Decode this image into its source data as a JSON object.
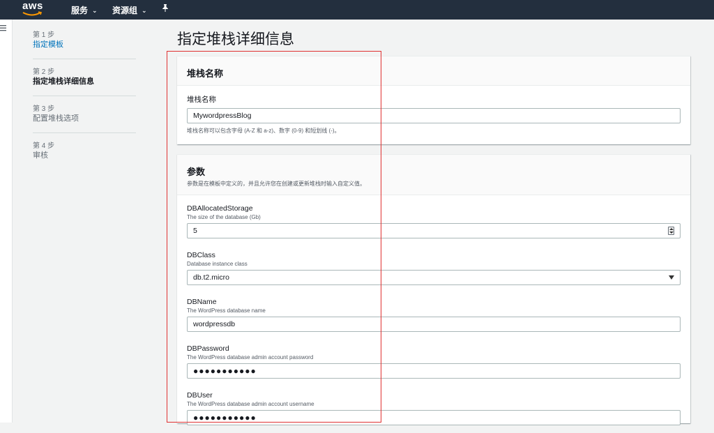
{
  "nav": {
    "logo": "aws",
    "services": "服务",
    "resource_groups": "资源组"
  },
  "steps": [
    {
      "num": "第 1 步",
      "title": "指定模板",
      "state": "link"
    },
    {
      "num": "第 2 步",
      "title": "指定堆栈详细信息",
      "state": "active"
    },
    {
      "num": "第 3 步",
      "title": "配置堆栈选项",
      "state": "inactive"
    },
    {
      "num": "第 4 步",
      "title": "审核",
      "state": "inactive"
    }
  ],
  "page_title": "指定堆栈详细信息",
  "stack_name_panel": {
    "header": "堆栈名称",
    "label": "堆栈名称",
    "value": "MywordpressBlog",
    "hint": "堆栈名称可以包含字母 (A-Z 和 a-z)、数字 (0-9) 和短划线 (-)。"
  },
  "params_panel": {
    "header": "参数",
    "description": "参数是在模板中定义的，并且允许您在创建或更新堆栈时输入自定义值。",
    "fields": [
      {
        "label": "DBAllocatedStorage",
        "desc": "The size of the database (Gb)",
        "value": "5",
        "type": "number"
      },
      {
        "label": "DBClass",
        "desc": "Database instance class",
        "value": "db.t2.micro",
        "type": "select"
      },
      {
        "label": "DBName",
        "desc": "The WordPress database name",
        "value": "wordpressdb",
        "type": "text"
      },
      {
        "label": "DBPassword",
        "desc": "The WordPress database admin account password",
        "value": "●●●●●●●●●●●",
        "type": "password"
      },
      {
        "label": "DBUser",
        "desc": "The WordPress database admin account username",
        "value": "●●●●●●●●●●●",
        "type": "password"
      }
    ]
  },
  "colors": {
    "topbar": "#232f3e",
    "link": "#0073bb",
    "highlight": "#e03131"
  }
}
